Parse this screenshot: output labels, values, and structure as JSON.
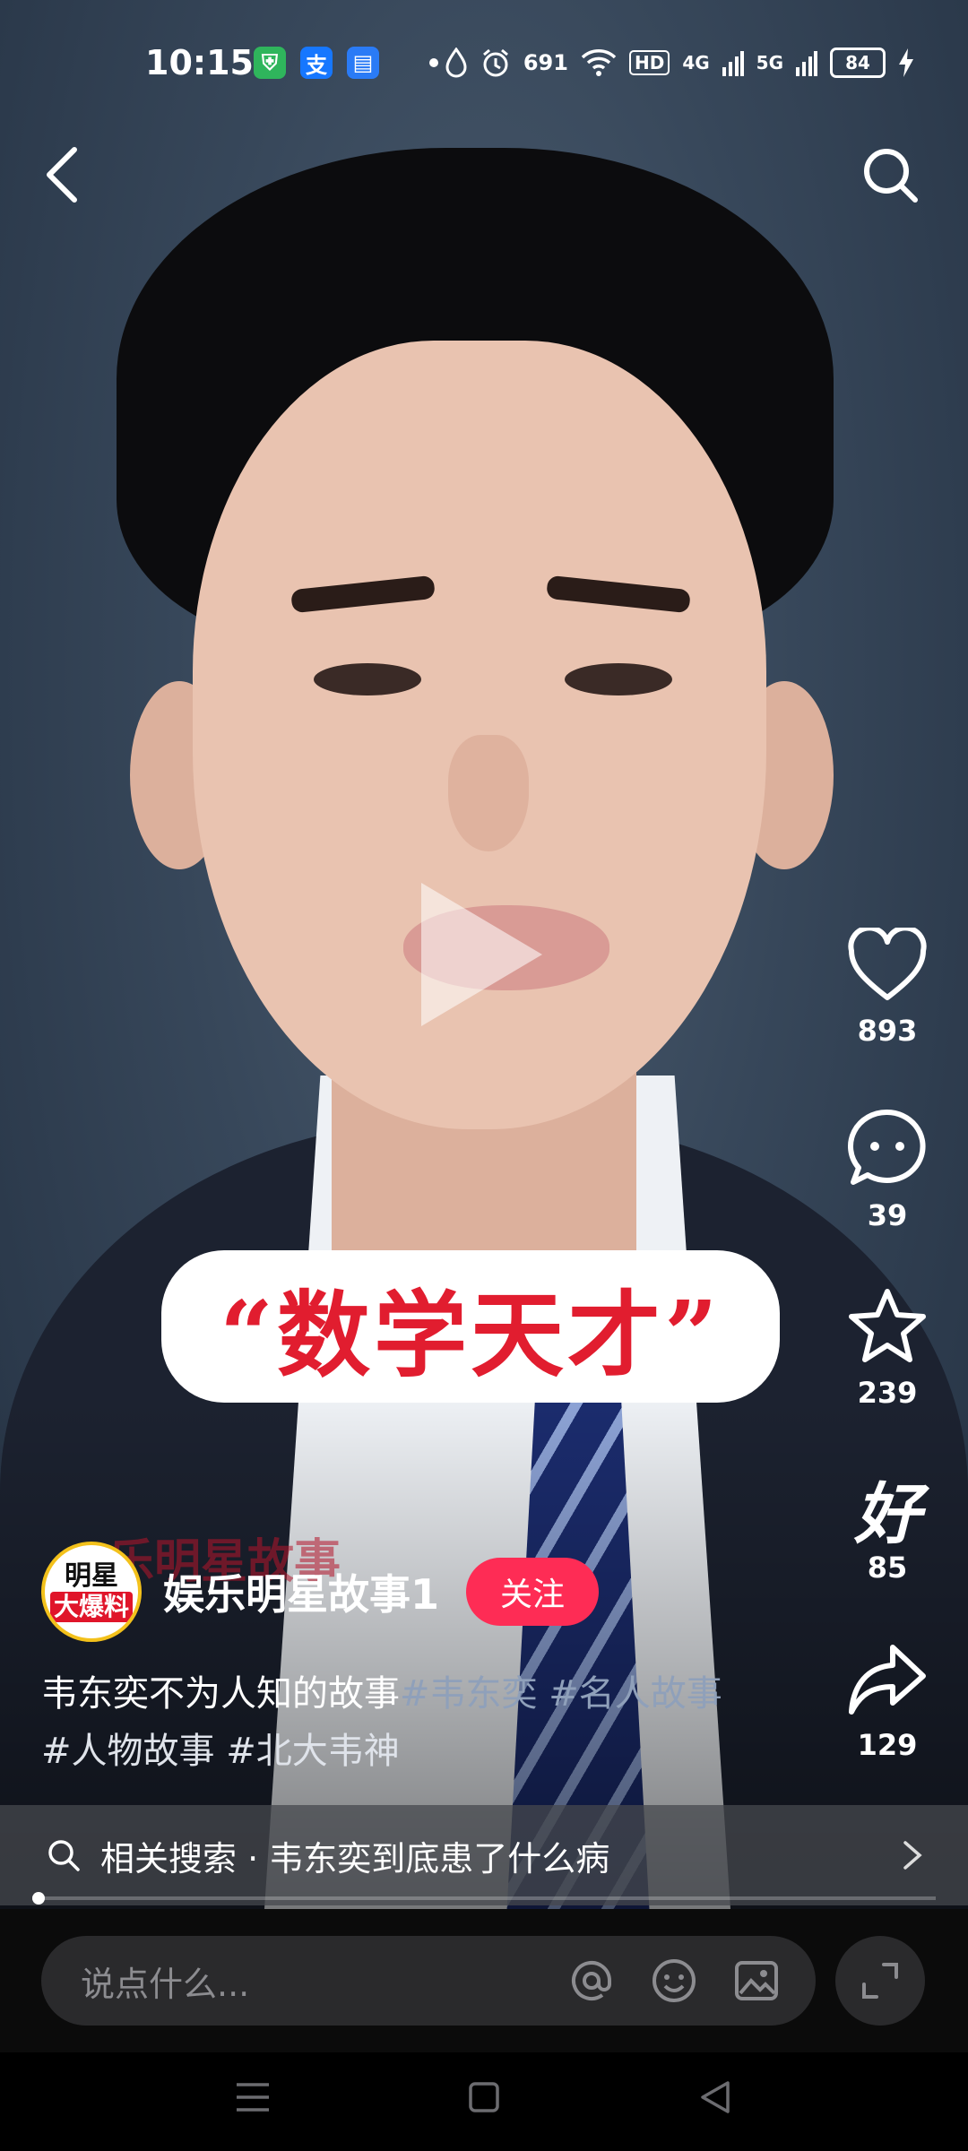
{
  "status_bar": {
    "time": "10:15",
    "app_icons": [
      {
        "icon": "shield-app-icon",
        "glyph": "⛨",
        "color": "#2fb55c"
      },
      {
        "icon": "alipay-icon",
        "glyph": "支",
        "color": "#1677ff"
      },
      {
        "icon": "files-app-icon",
        "glyph": "▤",
        "color": "#2a7bf6"
      }
    ],
    "speed": "691",
    "hd_label": "HD",
    "net_4g": "4G",
    "net_5g": "5G",
    "battery": "84"
  },
  "video": {
    "caption": "“数学天才”",
    "watermark": "乐明星故事"
  },
  "actions": {
    "like_count": "893",
    "comment_count": "39",
    "favorite_count": "239",
    "good_label": "好",
    "good_count": "85",
    "share_count": "129"
  },
  "author": {
    "avatar_line1": "明星",
    "avatar_line2": "大爆料",
    "name": "娱乐明星故事1",
    "follow_label": "关注"
  },
  "description": {
    "text": "韦东奕不为人知的故事",
    "tags": [
      "#韦东奕",
      "#名人故事",
      "#人物故事",
      "#北大韦神"
    ]
  },
  "related": {
    "text": "相关搜索 · 韦东奕到底患了什么病"
  },
  "comment_bar": {
    "placeholder": "说点什么..."
  },
  "colors": {
    "accent": "#fe2c55",
    "caption_red": "#e11d2f",
    "avatar_ring": "#f3c11b"
  }
}
